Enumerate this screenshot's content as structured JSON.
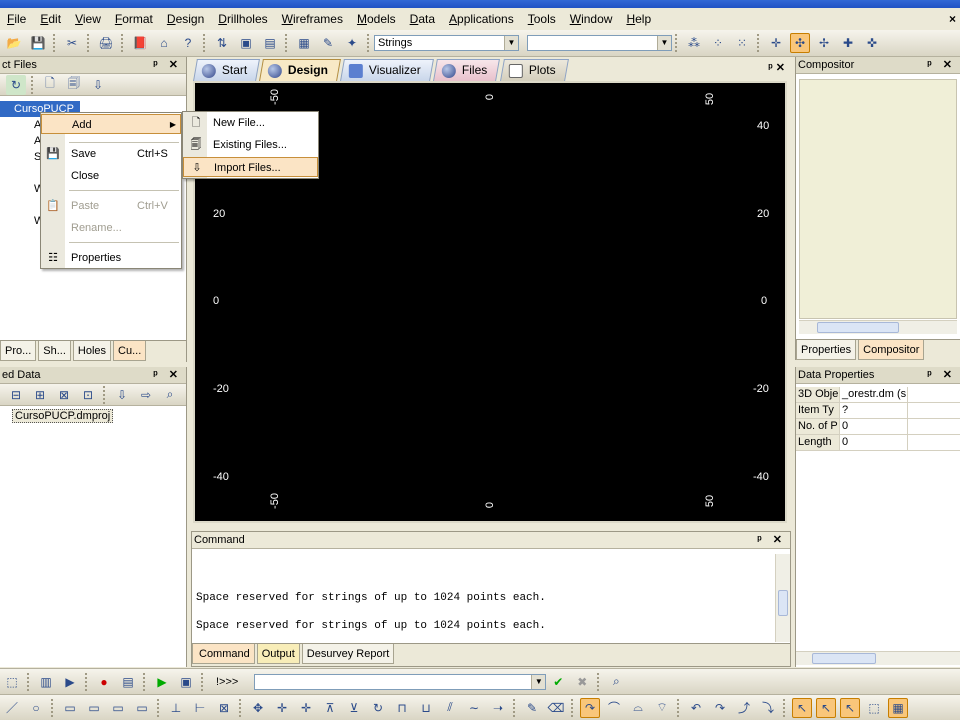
{
  "menubar": {
    "items": [
      "File",
      "Edit",
      "View",
      "Format",
      "Design",
      "Drillholes",
      "Wireframes",
      "Models",
      "Data",
      "Applications",
      "Tools",
      "Window",
      "Help"
    ],
    "close": "×"
  },
  "toolbar": {
    "strings_dropdown": "Strings",
    "second_dropdown": ""
  },
  "project_files": {
    "title": "ct Files",
    "root": "CursoPUCP",
    "tree_letters": [
      "A",
      "A",
      "S",
      "W",
      "W"
    ],
    "tabs": [
      "Pro...",
      "Sh...",
      "Holes",
      "Cu..."
    ]
  },
  "loaded_data": {
    "title": "ed Data",
    "item": "CursoPUCP.dmproj"
  },
  "context_menu": {
    "items": [
      {
        "label": "Add",
        "shortcut": ""
      },
      {
        "label": "Save",
        "shortcut": "Ctrl+S"
      },
      {
        "label": "Close",
        "shortcut": ""
      },
      {
        "label": "Paste",
        "shortcut": "Ctrl+V"
      },
      {
        "label": "Rename...",
        "shortcut": ""
      },
      {
        "label": "Properties",
        "shortcut": ""
      }
    ]
  },
  "submenu": {
    "items": [
      "New File...",
      "Existing Files...",
      "Import Files..."
    ]
  },
  "view_tabs": [
    "Start",
    "Design",
    "Visualizer",
    "Files",
    "Plots"
  ],
  "viewport": {
    "top_labels": [
      "-50",
      "0",
      "50"
    ],
    "bottom_labels": [
      "-50",
      "0",
      "50"
    ],
    "left_labels": [
      "20",
      "0",
      "-20",
      "-40"
    ],
    "right_labels": [
      "40",
      "20",
      "0",
      "-20",
      "-40"
    ]
  },
  "command": {
    "title": "Command",
    "lines": [
      "Space reserved for strings of up to 1024 points each.",
      "Space reserved for strings of up to 1024 points each."
    ],
    "tabs": [
      "Command",
      "Output",
      "Desurvey Report"
    ],
    "prompt": "!>>>"
  },
  "compositor": {
    "title": "Compositor",
    "tabs": [
      "Properties",
      "Compositor"
    ]
  },
  "data_properties": {
    "title": "Data Properties",
    "rows": [
      {
        "key": "3D Obje",
        "value": "_orestr.dm (s"
      },
      {
        "key": "Item Ty",
        "value": "?"
      },
      {
        "key": "No. of P",
        "value": "0"
      },
      {
        "key": "Length",
        "value": "0"
      }
    ]
  },
  "panel_controls": "ᵖ ✕",
  "colors": {
    "accent": "#fbe4c5",
    "viewport": "#000000",
    "tab_active": "#f8e9c6"
  }
}
